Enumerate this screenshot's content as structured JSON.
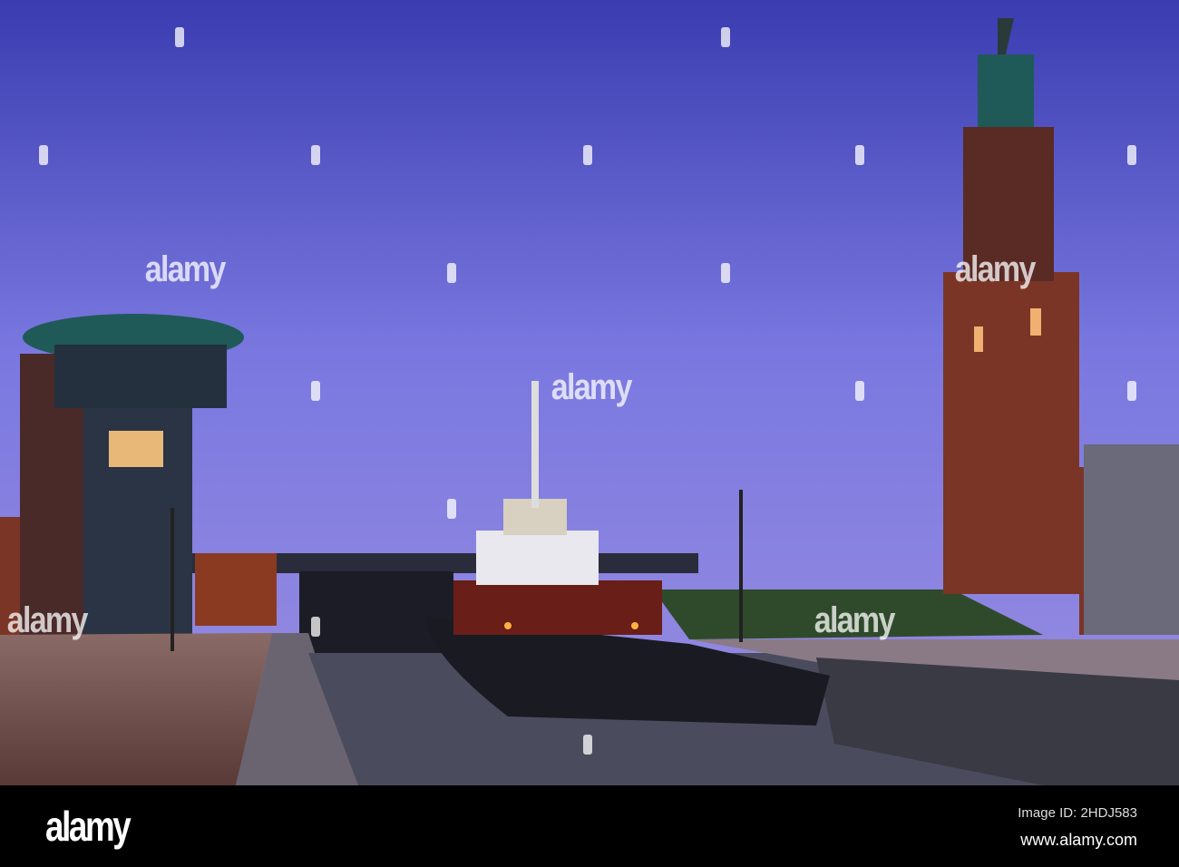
{
  "watermark": {
    "text": "alamy"
  },
  "footer": {
    "logo": "alamy",
    "image_id": "Image ID: 2HDJ583",
    "url": "www.alamy.com"
  },
  "colors": {
    "sky_top": "#3a3cb0",
    "sky_mid": "#7a78e0",
    "sky_bottom": "#9a8ee0",
    "brick": "#7a3526",
    "water": "#4a4c5e"
  }
}
